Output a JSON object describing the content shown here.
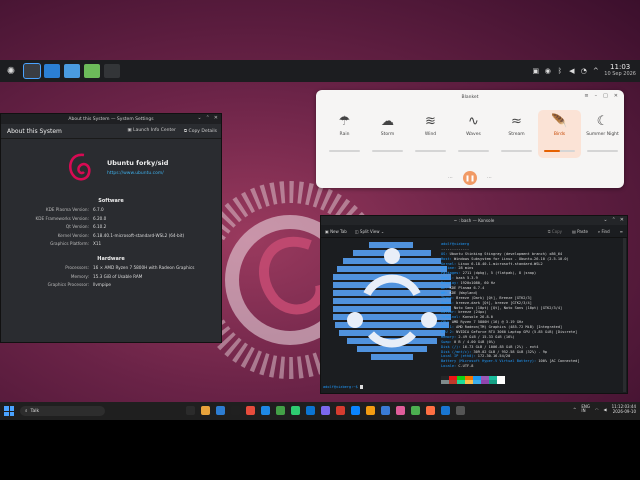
{
  "kde_panel": {
    "time": "11:03",
    "date": "10 Sep 2026",
    "tasks": [
      {
        "name": "kde-app-launcher",
        "color": "#3a3d43"
      },
      {
        "name": "system-settings",
        "color": "#2b7fd4"
      },
      {
        "name": "dolphin",
        "color": "#4a9be0"
      },
      {
        "name": "discover",
        "color": "#6cbb5a"
      },
      {
        "name": "konsole",
        "color": "#333538"
      }
    ]
  },
  "about": {
    "window_title": "About this System — System Settings",
    "header": "About this System",
    "launch_info": "Launch Info Center",
    "copy_details": "Copy Details",
    "distro": "Ubuntu forky/sid",
    "url": "https://www.ubuntu.com/",
    "software_title": "Software",
    "software": [
      {
        "k": "KDE Plasma Version:",
        "v": "6.7.0"
      },
      {
        "k": "KDE Frameworks Version:",
        "v": "6.20.0"
      },
      {
        "k": "Qt Version:",
        "v": "6.10.2"
      },
      {
        "k": "Kernel Version:",
        "v": "6.18.40.1-microsoft-standard-WSL2 (64-bit)"
      },
      {
        "k": "Graphics Platform:",
        "v": "X11"
      }
    ],
    "hardware_title": "Hardware",
    "hardware": [
      {
        "k": "Processors:",
        "v": "16 × AMD Ryzen 7 5800H with Radeon Graphics"
      },
      {
        "k": "Memory:",
        "v": "15.3 GiB of Usable RAM"
      },
      {
        "k": "Graphics Processor:",
        "v": "llvmpipe"
      }
    ]
  },
  "blanket": {
    "title": "Blanket",
    "sounds": [
      {
        "label": "Rain",
        "icon": "rain-icon",
        "glyph": "☂",
        "level": 0
      },
      {
        "label": "Storm",
        "icon": "storm-icon",
        "glyph": "☁",
        "level": 0
      },
      {
        "label": "Wind",
        "icon": "wind-icon",
        "glyph": "≋",
        "level": 0
      },
      {
        "label": "Waves",
        "icon": "waves-icon",
        "glyph": "∿",
        "level": 0
      },
      {
        "label": "Stream",
        "icon": "stream-icon",
        "glyph": "≈",
        "level": 0
      },
      {
        "label": "Birds",
        "icon": "birds-icon",
        "glyph": "🪶",
        "level": 0.5,
        "active": true
      },
      {
        "label": "Summer Night",
        "icon": "summer-night-icon",
        "glyph": "☾",
        "level": 0
      }
    ],
    "accent": "#e66100"
  },
  "konsole": {
    "window_title": "~ : bash — Konsole",
    "new_tab": "New Tab",
    "split_view": "Split View",
    "copy": "Copy",
    "paste": "Paste",
    "find": "Find",
    "user_host": "adolf@vizberg",
    "separator": "-------------",
    "info": [
      {
        "k": "OS:",
        "v": "Ubuntu Stinking Stingray (development branch) x86_64"
      },
      {
        "k": "Host:",
        "v": "Windows Subsystem for Linux - Ubuntu-26.10 (2.5.10.0)"
      },
      {
        "k": "Kernel:",
        "v": "Linux 6.18.40.1-microsoft-standard-WSL2"
      },
      {
        "k": "Uptime:",
        "v": "28 mins"
      },
      {
        "k": "Packages:",
        "v": "2711 (dpkg), 5 (flatpak), 8 (snap)"
      },
      {
        "k": "Shell:",
        "v": "bash 5.3.9"
      },
      {
        "k": "Display:",
        "v": "1920x1080, 60 Hz"
      },
      {
        "k": "DE:",
        "v": "KDE Plasma 6.7.4"
      },
      {
        "k": "WM:",
        "v": "KDE (Wayland)"
      },
      {
        "k": "Theme:",
        "v": "Breeze (Dark) [Qt], Breeze [GTK2/3]"
      },
      {
        "k": "Icons:",
        "v": "breeze-dark [Qt], breeze [GTK2/3/4]"
      },
      {
        "k": "Font:",
        "v": "Noto Sans (10pt) [Qt], Noto Sans (10pt) [GTK2/3/4]"
      },
      {
        "k": "Cursor:",
        "v": "breeze (24px)"
      },
      {
        "k": "Terminal:",
        "v": "Konsole 26.8.0"
      },
      {
        "k": "CPU:",
        "v": "AMD Ryzen 7 5800H (16) @ 3.19 GHz"
      },
      {
        "k": "GPU 1:",
        "v": "AMD Radeon(TM) Graphics (485.72 MiB) [Integrated]"
      },
      {
        "k": "GPU 2:",
        "v": "NVIDIA GeForce RTX 3060 Laptop GPU (5.85 GiB) [Discrete]"
      },
      {
        "k": "Memory:",
        "v": "2.49 GiB / 15.33 GiB (16%)"
      },
      {
        "k": "Swap:",
        "v": "0 B / 4.00 GiB (0%)"
      },
      {
        "k": "Disk (/):",
        "v": "16.73 GiB / 1006.85 GiB (2%) - ext4"
      },
      {
        "k": "Disk (/mnt/c):",
        "v": "309.02 GiB / 952.58 GiB (32%) - 9p"
      },
      {
        "k": "Local IP (eth0):",
        "v": "172.30.16.54/20"
      },
      {
        "k": "Battery (Microsoft Hyper-V Virtual Battery):",
        "v": "100% [AC Connected]"
      },
      {
        "k": "Locale:",
        "v": "C.UTF-8"
      }
    ],
    "prompt": "adolf@vizberg:~$",
    "palette": [
      "#232627",
      "#ed1515",
      "#11d116",
      "#f67400",
      "#1d99f3",
      "#9b59b6",
      "#1abc9c",
      "#fcfcfc",
      "#7f8c8d",
      "#c0392b",
      "#1cdc9a",
      "#fdbc4b",
      "#3daee9",
      "#8e44ad",
      "#16a085",
      "#ffffff"
    ]
  },
  "taskbar": {
    "search": "Talk",
    "lang": "ENG\nIN",
    "time": "11:12:03:44",
    "date": "2026-09-10",
    "apps": [
      "#2b2b2b",
      "#e8a33b",
      "#2d7dd2",
      "#202020",
      "#e74c3c",
      "#1e88e5",
      "#43a047",
      "#2ecc71",
      "#0b74d1",
      "#7b68ee",
      "#d63c2f",
      "#0a84ff",
      "#f39c12",
      "#3a7bd5",
      "#e05d9a",
      "#4caf50",
      "#ff7043",
      "#1976d2",
      "#555555"
    ]
  }
}
